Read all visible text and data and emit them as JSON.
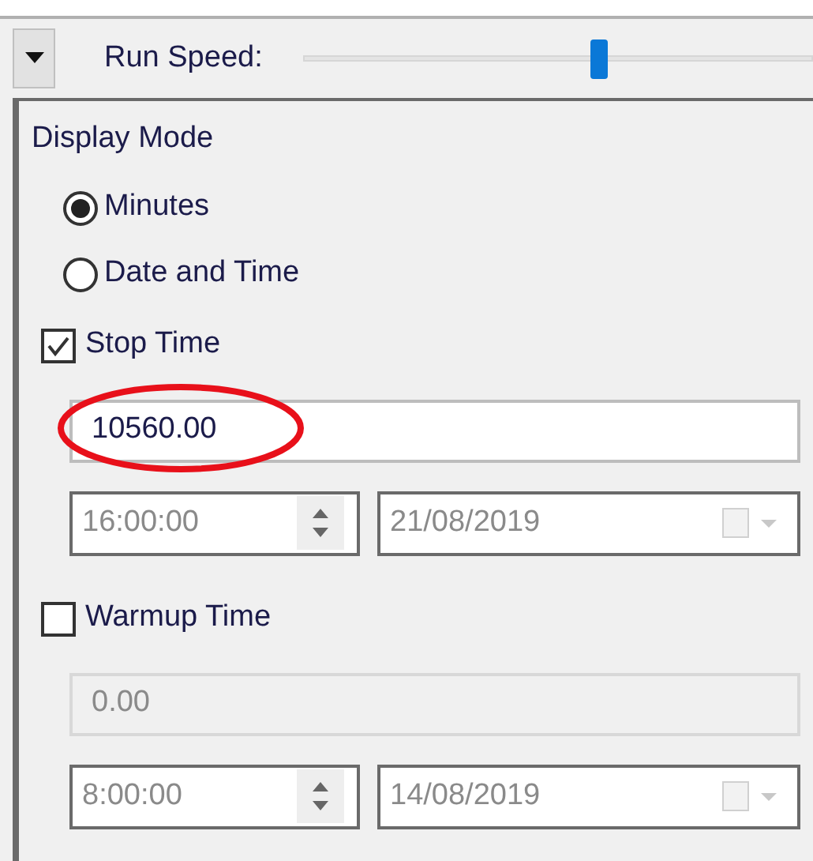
{
  "toolbar": {
    "collapsed": true,
    "label": "Run Speed:",
    "run_speed": {
      "level": 0.58
    }
  },
  "display_mode": {
    "title": "Display Mode",
    "options": [
      {
        "label": "Minutes",
        "selected": true
      },
      {
        "label": "Date and Time",
        "selected": false
      }
    ]
  },
  "sections": [
    {
      "label": "Stop Time",
      "checked": true,
      "value": "10560.00",
      "value_disabled": false,
      "highlighted": true,
      "time": "16:00:00",
      "date": "21/08/2019",
      "datetime_disabled": true
    },
    {
      "label": "Warmup Time",
      "checked": false,
      "value": "0.00",
      "value_disabled": true,
      "highlighted": false,
      "time": "8:00:00",
      "date": "14/08/2019",
      "datetime_disabled": true
    }
  ]
}
